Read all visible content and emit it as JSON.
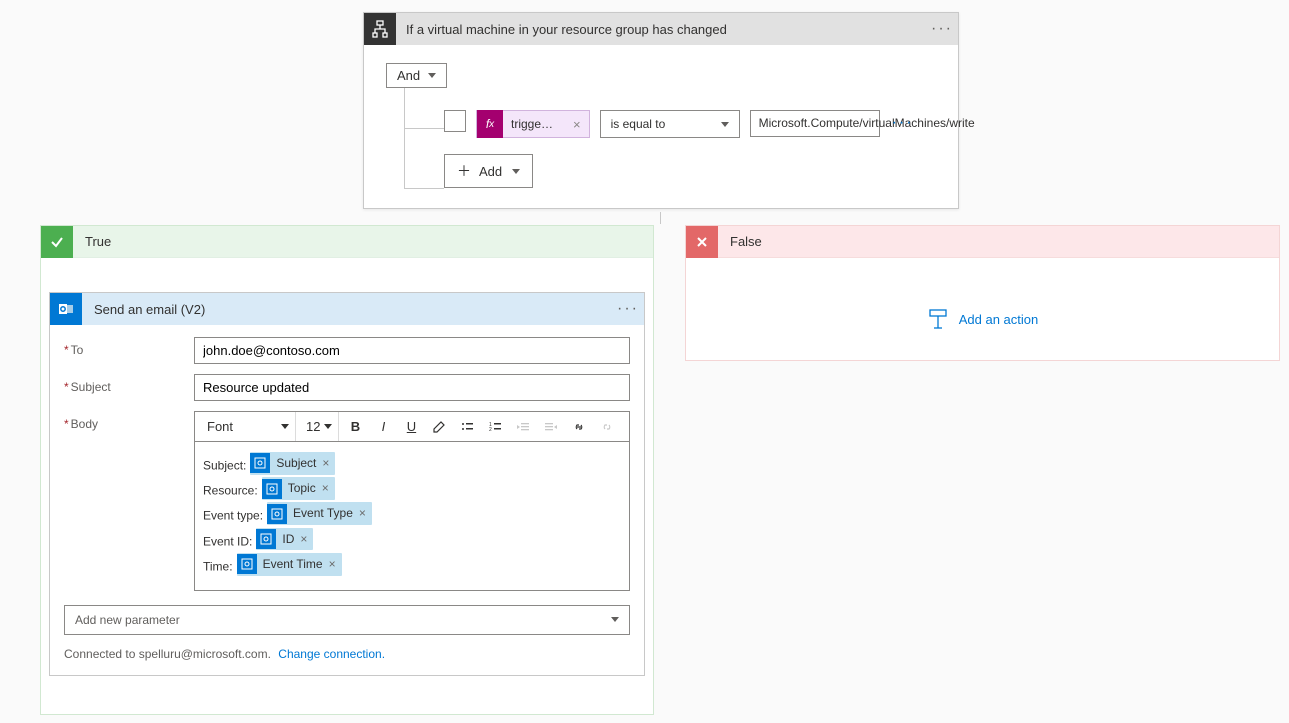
{
  "condition": {
    "title": "If a virtual machine in your resource group has changed",
    "groupOperator": "And",
    "expressionChip": "triggerB...",
    "comparisonOperator": "is equal to",
    "comparisonValue": "Microsoft.Compute/virtualMachines/write",
    "addLabel": "Add"
  },
  "trueBranch": {
    "title": "True"
  },
  "falseBranch": {
    "title": "False",
    "addAction": "Add an action"
  },
  "action": {
    "title": "Send an email (V2)",
    "labels": {
      "to": "To",
      "subject": "Subject",
      "body": "Body"
    },
    "to": "john.doe@contoso.com",
    "subject": "Resource updated",
    "toolbar": {
      "font": "Font",
      "size": "12"
    },
    "bodyLines": [
      {
        "prefix": "Subject:",
        "token": "Subject"
      },
      {
        "prefix": "Resource:",
        "token": "Topic"
      },
      {
        "prefix": "Event type:",
        "token": "Event Type"
      },
      {
        "prefix": "Event ID:",
        "token": "ID"
      },
      {
        "prefix": "Time:",
        "token": "Event Time"
      }
    ],
    "newParamPlaceholder": "Add new parameter",
    "connectedPrefix": "Connected to spelluru@microsoft.com.",
    "changeConnection": "Change connection."
  }
}
